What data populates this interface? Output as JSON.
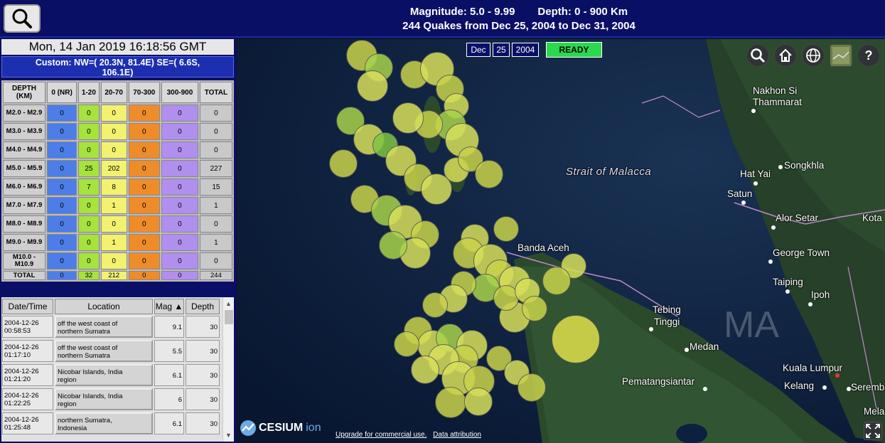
{
  "header": {
    "magnitude": "Magnitude: 5.0 - 9.99",
    "depth": "Depth: 0 - 900 Km",
    "summary": "244 Quakes from Dec 25, 2004 to Dec 31, 2004"
  },
  "left": {
    "date": "Mon, 14 Jan 2019 16:18:56 GMT",
    "custom_line1": "Custom: NW=( 20.3N, 81.4E)  SE=( 6.6S,",
    "custom_line2": "106.1E)",
    "stats": {
      "headers": [
        "DEPTH (KM)",
        "0 (NR)",
        "1-20",
        "20-70",
        "70-300",
        "300-900",
        "TOTAL"
      ],
      "rows": [
        {
          "label": "M2.0 - M2.9",
          "v": [
            "0",
            "0",
            "0",
            "0",
            "0",
            "0"
          ]
        },
        {
          "label": "M3.0 - M3.9",
          "v": [
            "0",
            "0",
            "0",
            "0",
            "0",
            "0"
          ]
        },
        {
          "label": "M4.0 - M4.9",
          "v": [
            "0",
            "0",
            "0",
            "0",
            "0",
            "0"
          ]
        },
        {
          "label": "M5.0 - M5.9",
          "v": [
            "0",
            "25",
            "202",
            "0",
            "0",
            "227"
          ]
        },
        {
          "label": "M6.0 - M6.9",
          "v": [
            "0",
            "7",
            "8",
            "0",
            "0",
            "15"
          ]
        },
        {
          "label": "M7.0 - M7.9",
          "v": [
            "0",
            "0",
            "1",
            "0",
            "0",
            "1"
          ]
        },
        {
          "label": "M8.0 - M8.9",
          "v": [
            "0",
            "0",
            "0",
            "0",
            "0",
            "0"
          ]
        },
        {
          "label": "M9.0 - M9.9",
          "v": [
            "0",
            "0",
            "1",
            "0",
            "0",
            "1"
          ]
        },
        {
          "label": "M10.0 - M10.9",
          "v": [
            "0",
            "0",
            "0",
            "0",
            "0",
            "0"
          ]
        }
      ],
      "total": {
        "label": "TOTAL",
        "v": [
          "0",
          "32",
          "212",
          "0",
          "0",
          "244"
        ]
      }
    },
    "list": {
      "headers": [
        "Date/Time",
        "Location",
        "Mag ▲",
        "Depth"
      ],
      "rows": [
        {
          "date": "2004-12-26",
          "time": "00:58:53",
          "loc1": "off the west coast of",
          "loc2": "northern Sumatra",
          "mag": "9.1",
          "depth": "30"
        },
        {
          "date": "2004-12-26",
          "time": "01:17:10",
          "loc1": "off the west coast of",
          "loc2": "northern Sumatra",
          "mag": "5.5",
          "depth": "30"
        },
        {
          "date": "2004-12-26",
          "time": "01:21:20",
          "loc1": "Nicobar Islands, India",
          "loc2": "region",
          "mag": "6.1",
          "depth": "30"
        },
        {
          "date": "2004-12-26",
          "time": "01:22:25",
          "loc1": "Nicobar Islands, India",
          "loc2": "region",
          "mag": "6",
          "depth": "30"
        },
        {
          "date": "2004-12-26",
          "time": "01:25:48",
          "loc1": "northern Sumatra,",
          "loc2": "Indonesia",
          "mag": "6.1",
          "depth": "30"
        }
      ]
    }
  },
  "map": {
    "date_month": "Dec",
    "date_day": "25",
    "date_year": "2004",
    "status": "READY",
    "labels": {
      "nakhon1": "Nakhon Si",
      "nakhon2": "Thammarat",
      "strait": "Strait of Malacca",
      "hatyai": "Hat Yai",
      "songkhla": "Songkhla",
      "satun": "Satun",
      "alorsetar": "Alor Setar",
      "kota": "Kota",
      "bandaaceh": "Banda Aceh",
      "georgetown": "George Town",
      "taiping": "Taiping",
      "ipoh": "Ipoh",
      "tebing1": "Tebing",
      "tebing2": "Tinggi",
      "medan": "Medan",
      "kualalumpur": "Kuala Lumpur",
      "pematang": "Pematangsiantar",
      "kelang": "Kelang",
      "seremban": "Seremb",
      "mela": "Mela",
      "ma": "MA"
    },
    "cesium_logo": "CESIUM",
    "cesium_ion": "ion",
    "upgrade": "Upgrade for commercial use.",
    "attribution": "Data attribution",
    "icons": [
      "search-icon",
      "home-icon",
      "globe-icon",
      "basemap-icon",
      "help-icon"
    ]
  }
}
